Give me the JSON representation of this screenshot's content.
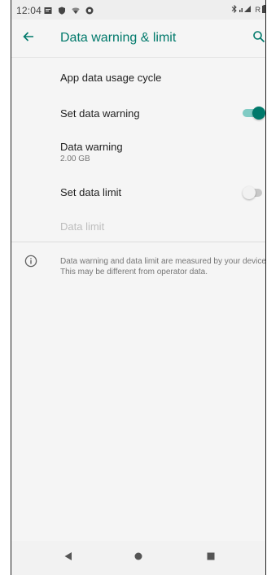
{
  "status_bar": {
    "time": "12:04",
    "left_icons": [
      "notification-icon",
      "shield-icon",
      "wifi-icon",
      "sync-icon"
    ],
    "right_icons": [
      "bluetooth-icon",
      "signal-icon",
      "battery-icon"
    ],
    "network_text": "R"
  },
  "toolbar": {
    "title": "Data warning & limit",
    "back_icon": "arrow-left-icon",
    "search_icon": "search-icon"
  },
  "settings": {
    "app_data_usage_cycle": {
      "title": "App data usage cycle"
    },
    "set_data_warning": {
      "title": "Set data warning",
      "enabled": true
    },
    "data_warning": {
      "title": "Data warning",
      "value": "2.00 GB"
    },
    "set_data_limit": {
      "title": "Set data limit",
      "enabled": false
    },
    "data_limit": {
      "title": "Data limit",
      "disabled": true
    }
  },
  "info": {
    "icon": "info-icon",
    "text": "Data warning and data limit are measured by your device. This may be different from operator data."
  },
  "nav_bar": {
    "back_icon": "nav-back-icon",
    "home_icon": "nav-home-icon",
    "recents_icon": "nav-recents-icon"
  },
  "colors": {
    "accent": "#00796b",
    "accent_light": "#80cbc4",
    "background": "#f5f5f5"
  }
}
